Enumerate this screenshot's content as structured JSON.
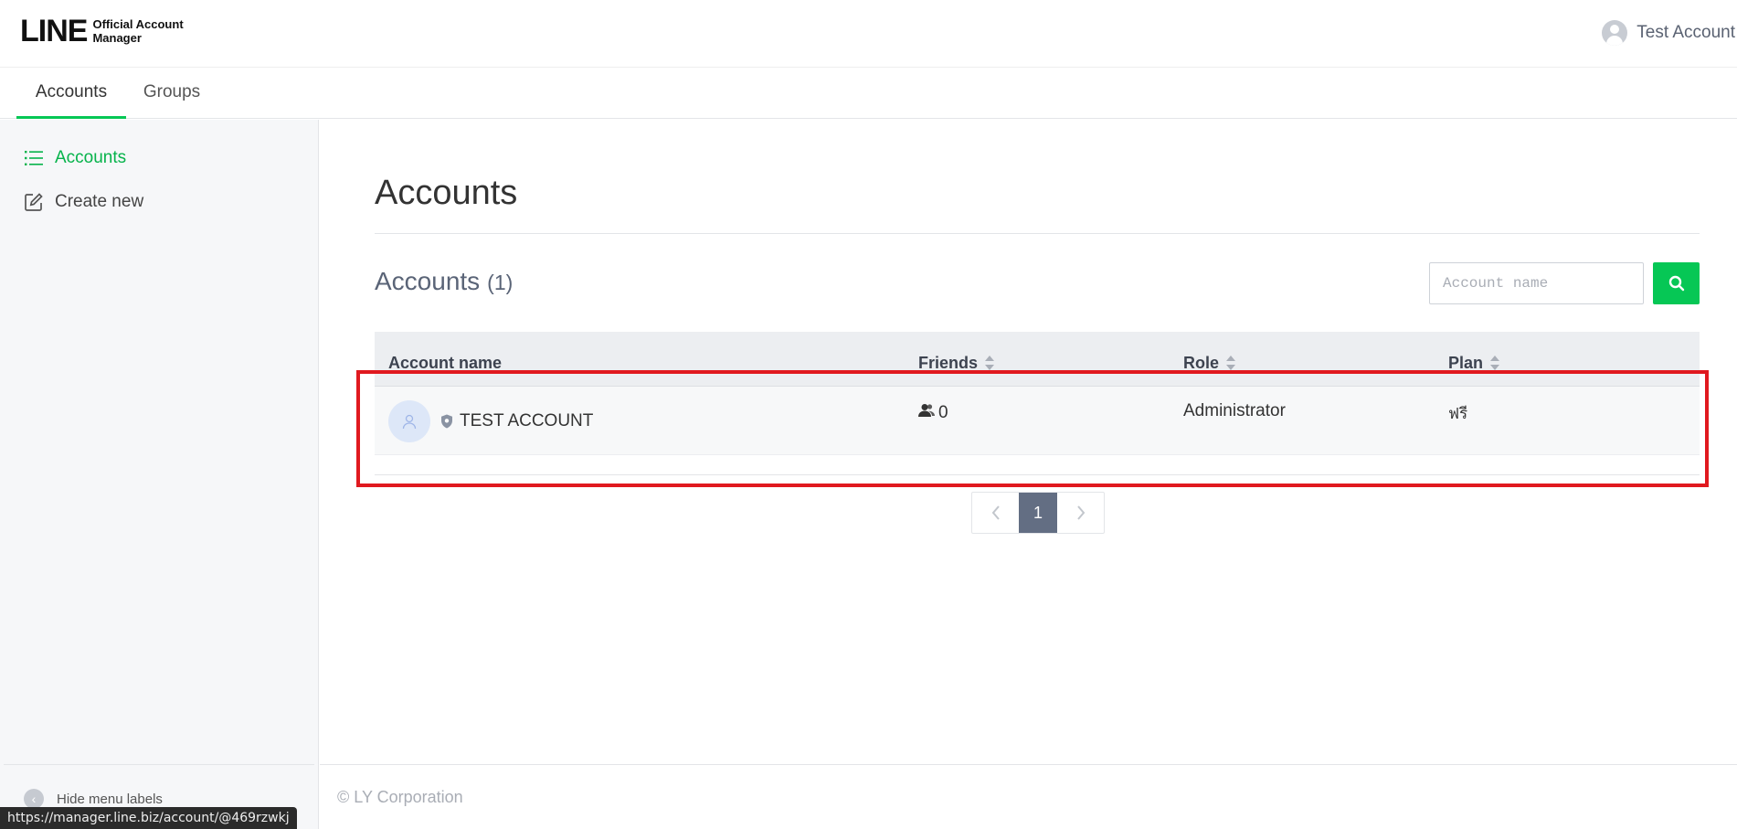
{
  "header": {
    "logo_main": "LINE",
    "logo_sub_line1": "Official Account",
    "logo_sub_line2": "Manager",
    "user_name": "Test Account"
  },
  "tabs": [
    {
      "label": "Accounts",
      "active": true
    },
    {
      "label": "Groups",
      "active": false
    }
  ],
  "sidebar": {
    "items": [
      {
        "label": "Accounts",
        "icon": "list-icon",
        "active": true
      },
      {
        "label": "Create new",
        "icon": "edit-icon",
        "active": false
      }
    ],
    "hide_label": "Hide menu labels"
  },
  "main": {
    "title": "Accounts",
    "section_title": "Accounts",
    "section_count": "(1)",
    "search": {
      "placeholder": "Account name",
      "value": ""
    }
  },
  "table": {
    "columns": [
      "Account name",
      "Friends",
      "Role",
      "Plan"
    ],
    "rows": [
      {
        "account_name": "TEST ACCOUNT",
        "friends": "0",
        "role": "Administrator",
        "plan": "ฟรี"
      }
    ]
  },
  "pagination": {
    "current": "1"
  },
  "footer": {
    "copyright": "© LY Corporation"
  },
  "statusbar": {
    "url": "https://manager.line.biz/account/@469rzwkj"
  },
  "colors": {
    "accent": "#06c755",
    "highlight": "#e0191f",
    "pagination_active": "#636e83"
  }
}
